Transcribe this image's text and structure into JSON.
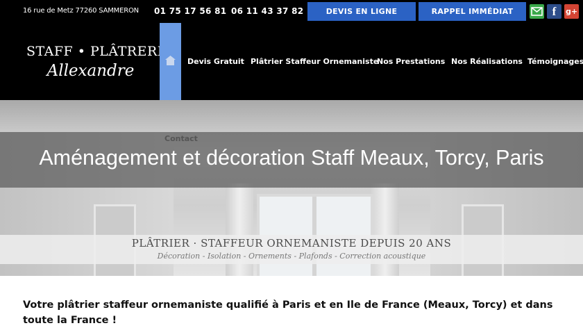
{
  "topbar": {
    "address": "16 rue de Metz  77260 SAMMERON",
    "phone1": "01 75 17 56 81",
    "phone2": "06 11 43 37 82",
    "devis_button": "DEVIS EN LIGNE",
    "rappel_button": "RAPPEL IMMÉDIAT",
    "social": {
      "mail_icon": "mail-icon",
      "facebook_glyph": "f",
      "googleplus_glyph": "g+"
    }
  },
  "header": {
    "logo_line1": "STAFF • PLÂTRERIE",
    "logo_line2": "Allexandre",
    "nav": [
      {
        "label": "Devis Gratuit"
      },
      {
        "label": "Plâtrier Staffeur Ornemaniste"
      },
      {
        "label": "Nos Prestations"
      },
      {
        "label": "Nos Réalisations"
      },
      {
        "label": "Témoignages"
      }
    ],
    "contact": "Contact"
  },
  "hero": {
    "title": "Aménagement et décoration Staff Meaux, Torcy, Paris",
    "tagline": "PLÂTRIER · STAFFEUR ORNEMANISTE DEPUIS 20 ANS",
    "subtagline": "Décoration - Isolation - Ornements - Plafonds - Correction acoustique"
  },
  "content": {
    "intro": "Votre plâtrier staffeur ornemaniste qualifié à Paris et en Ile de France (Meaux, Torcy) et dans toute la France !"
  },
  "colors": {
    "accent_blue": "#2b62c4",
    "home_tab": "#6c9ce4",
    "mail_green": "#3aa84a",
    "facebook": "#2d4d8a",
    "googleplus": "#d34434"
  }
}
